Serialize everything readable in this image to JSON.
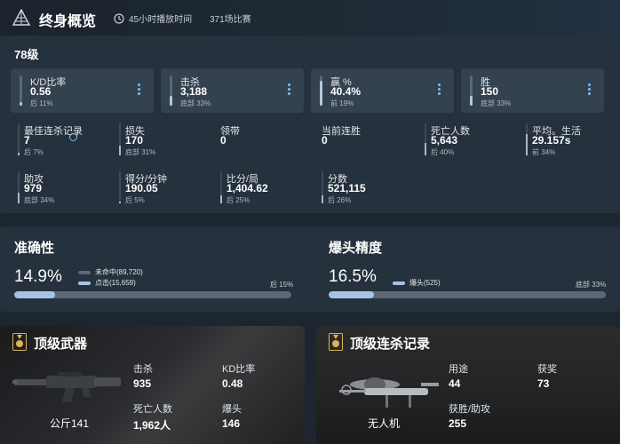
{
  "header": {
    "title": "终身概览",
    "playtime": "45小时播放时间",
    "matches": "371场比赛"
  },
  "level": "78级",
  "cards": [
    {
      "label": "K/D比率",
      "value": "0.56",
      "rank": "后 11%",
      "fill": 0.11
    },
    {
      "label": "击杀",
      "value": "3,188",
      "rank": "底部 33%",
      "fill": 0.33
    },
    {
      "label": "赢 %",
      "value": "40.4%",
      "rank": "前 19%",
      "fill": 0.81
    },
    {
      "label": "胜",
      "value": "150",
      "rank": "底部 33%",
      "fill": 0.33
    }
  ],
  "stats_row1": [
    {
      "label": "最佳连杀记录",
      "value": "7",
      "rank": "后 7%",
      "fill": 0.07
    },
    {
      "label": "损失",
      "value": "170",
      "rank": "底部 31%",
      "fill": 0.31
    },
    {
      "label": "领带",
      "value": "0",
      "rank": "",
      "fill": 0
    },
    {
      "label": "当前连胜",
      "value": "0",
      "rank": "",
      "fill": 0
    },
    {
      "label": "死亡人数",
      "value": "5,643",
      "rank": "后 40%",
      "fill": 0.4
    },
    {
      "label": "平均。生活",
      "value": "29.157s",
      "rank": "前 34%",
      "fill": 0.66
    }
  ],
  "stats_row2": [
    {
      "label": "助攻",
      "value": "979",
      "rank": "底部 34%",
      "fill": 0.34
    },
    {
      "label": "得分/分钟",
      "value": "190.05",
      "rank": "后 5%",
      "fill": 0.05
    },
    {
      "label": "比分/局",
      "value": "1,404.62",
      "rank": "后 25%",
      "fill": 0.25
    },
    {
      "label": "分数",
      "value": "521,115",
      "rank": "后 26%",
      "fill": 0.26
    }
  ],
  "accuracy": {
    "title": "准确性",
    "percent": "14.9%",
    "fill": 0.149,
    "legend": [
      "未命中(89,720)",
      "点击(15,659)"
    ],
    "rank": "后 15%"
  },
  "headshot": {
    "title": "爆头精度",
    "percent": "16.5%",
    "fill": 0.165,
    "legend": [
      "爆头(525)"
    ],
    "rank": "底部 33%"
  },
  "top_weapon": {
    "title": "顶级武器",
    "name": "公斤141",
    "stats": [
      {
        "label": "击杀",
        "value": "935"
      },
      {
        "label": "KD比率",
        "value": "0.48"
      },
      {
        "label": "死亡人数",
        "value": "1,962人"
      },
      {
        "label": "爆头",
        "value": "146"
      }
    ]
  },
  "top_streak": {
    "title": "顶级连杀记录",
    "name": "无人机",
    "stats": [
      {
        "label": "用途",
        "value": "44"
      },
      {
        "label": "获奖",
        "value": "73"
      },
      {
        "label": "获胜/助攻",
        "value": "255"
      }
    ]
  },
  "colors": {
    "accent": "#7cc0ff",
    "panel": "#25313d",
    "card": "#34414f",
    "background": "#1d2630"
  }
}
